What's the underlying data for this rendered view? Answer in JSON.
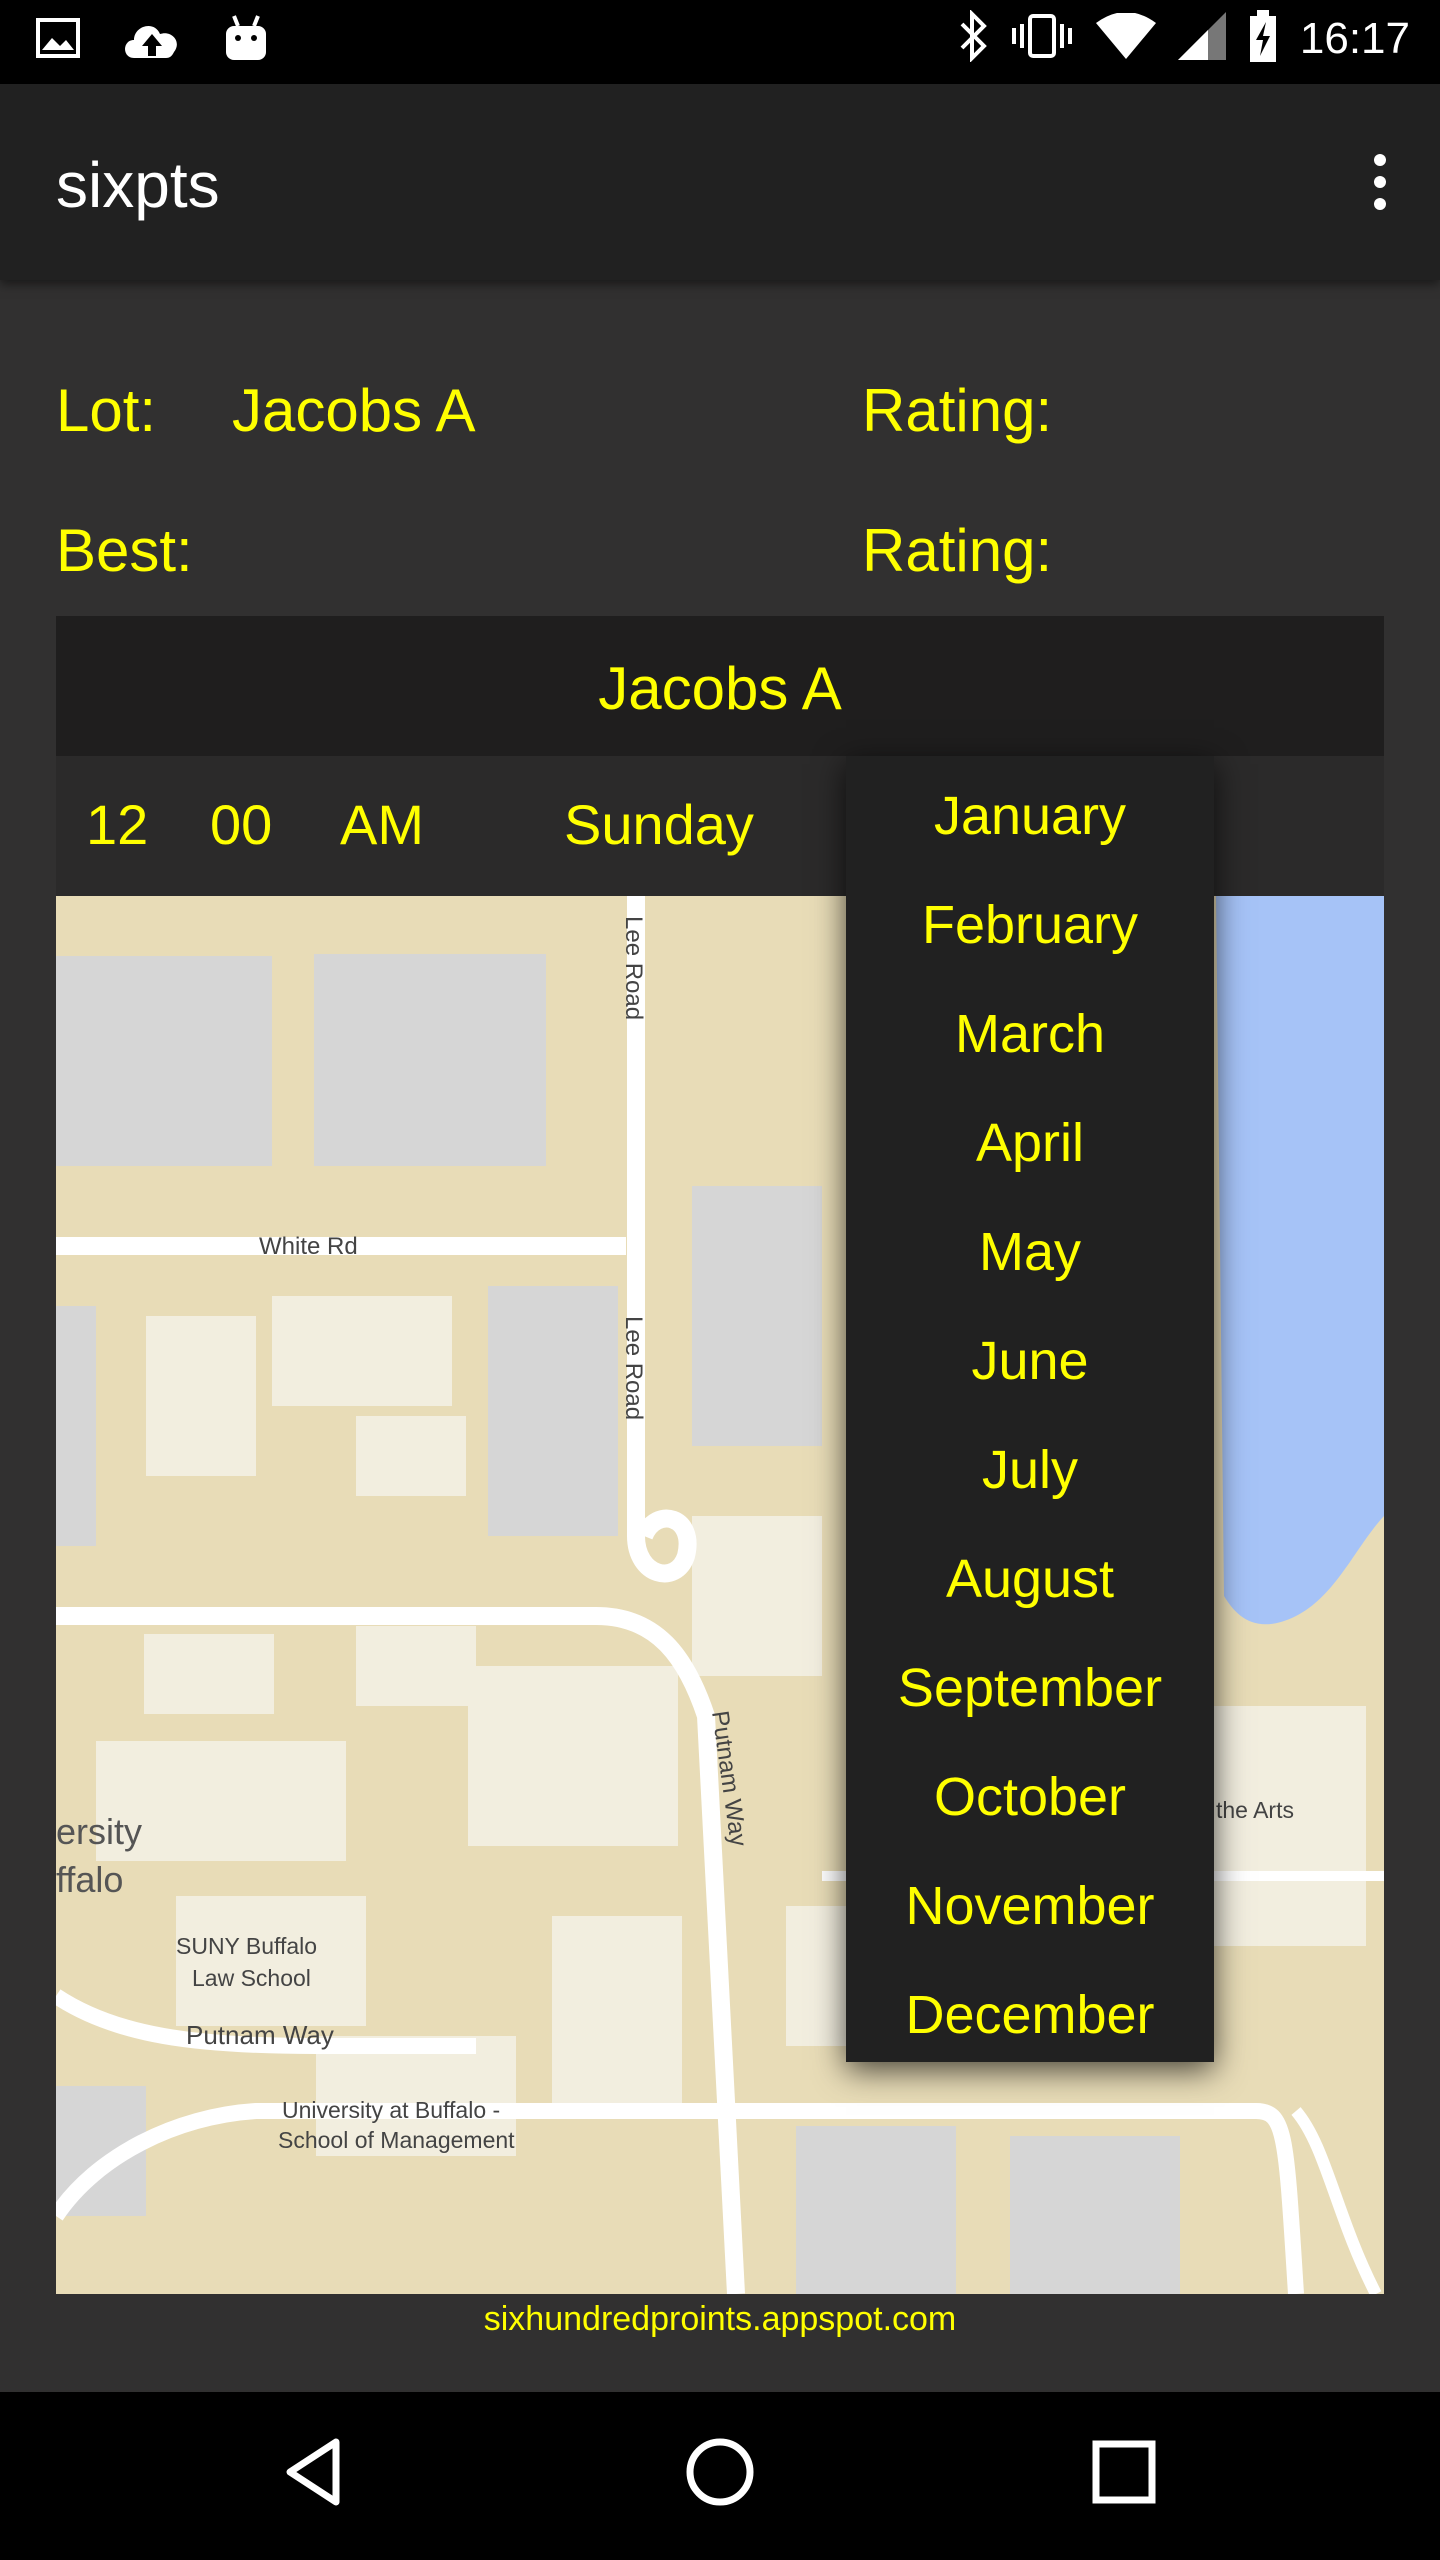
{
  "status_bar": {
    "time": "16:17",
    "left_icons": [
      "image-icon",
      "cloud-upload-icon",
      "android-icon"
    ],
    "right_icons": [
      "bluetooth-icon",
      "vibrate-icon",
      "wifi-icon",
      "signal-icon",
      "battery-icon"
    ]
  },
  "app_bar": {
    "title": "sixpts",
    "menu_icon": "overflow-menu-icon"
  },
  "info": {
    "lot_label": "Lot:",
    "lot_value": "Jacobs A",
    "rating_label_1": "Rating:",
    "best_label": "Best:",
    "rating_label_2": "Rating:"
  },
  "panel": {
    "title": "Jacobs A",
    "hour": "12",
    "minute": "00",
    "ampm": "AM",
    "day": "Sunday"
  },
  "map": {
    "labels": {
      "white_rd": "White Rd",
      "lee_road_1": "Lee Road",
      "lee_road_2": "Lee Road",
      "putnam_way_vertical": "Putnam Way",
      "putnam_way": "Putnam Way",
      "suny_law_1": "SUNY Buffalo",
      "suny_law_2": "Law School",
      "ub_mgmt_1": "University at Buffalo -",
      "ub_mgmt_2": "School of Management",
      "ersity": "ersity",
      "ffalo": "ffalo",
      "the_arts": "the Arts"
    },
    "colors": {
      "land": "#e8dcb7",
      "water": "#a6c3f7",
      "building": "#f2eedf",
      "parking": "#d6d6d6",
      "road": "#ffffff"
    }
  },
  "months_dropdown": {
    "items": [
      "January",
      "February",
      "March",
      "April",
      "May",
      "June",
      "July",
      "August",
      "September",
      "October",
      "November",
      "December"
    ]
  },
  "footer": {
    "link": "sixhundredproints.appspot.com"
  },
  "nav_bar": {
    "back": "back-icon",
    "home": "home-icon",
    "recents": "recents-icon"
  },
  "accent_color": "#ffff00"
}
